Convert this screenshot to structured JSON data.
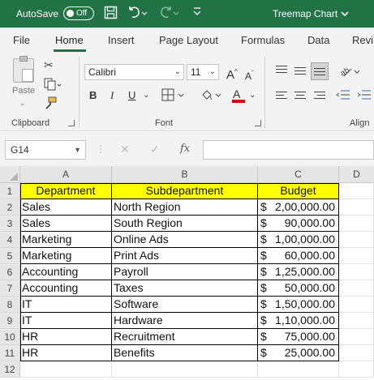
{
  "titlebar": {
    "autosave_label": "AutoSave",
    "autosave_state": "Off",
    "title": "Treemap Chart",
    "title_chevron": "⌄",
    "save_icon": "save-icon",
    "undo_icon": "undo-icon",
    "redo_icon": "redo-icon",
    "customize_icon": "customize-icon"
  },
  "menu": {
    "tabs": [
      "File",
      "Home",
      "Insert",
      "Page Layout",
      "Formulas",
      "Data",
      "Revi"
    ],
    "active": "Home"
  },
  "ribbon": {
    "clipboard": {
      "label": "Clipboard",
      "paste_label": "Paste"
    },
    "font": {
      "label": "Font",
      "font_name": "Calibri",
      "font_size": "11",
      "bold": "B",
      "italic": "I",
      "underline": "U",
      "grow": "A",
      "shrink": "A",
      "font_color": "A"
    },
    "alignment": {
      "label": "Align"
    }
  },
  "formula_bar": {
    "name_box": "G14",
    "fx_label": "fx",
    "cancel_icon": "✕",
    "enter_icon": "✓",
    "value": ""
  },
  "grid": {
    "columns": [
      "A",
      "B",
      "C",
      "D"
    ],
    "rows": [
      "1",
      "2",
      "3",
      "4",
      "5",
      "6",
      "7",
      "8",
      "9",
      "10",
      "11",
      "12"
    ],
    "header": [
      "Department",
      "Subdepartment",
      "Budget"
    ],
    "header_fill": "#ffff00",
    "data": [
      [
        "Sales",
        "North Region",
        "$",
        "2,00,000.00"
      ],
      [
        "Sales",
        "South Region",
        "$",
        "90,000.00"
      ],
      [
        "Marketing",
        "Online Ads",
        "$",
        "1,00,000.00"
      ],
      [
        "Marketing",
        "Print Ads",
        "$",
        "60,000.00"
      ],
      [
        "Accounting",
        "Payroll",
        "$",
        "1,25,000.00"
      ],
      [
        "Accounting",
        "Taxes",
        "$",
        "50,000.00"
      ],
      [
        "IT",
        "Software",
        "$",
        "1,50,000.00"
      ],
      [
        "IT",
        "Hardware",
        "$",
        "1,10,000.00"
      ],
      [
        "HR",
        "Recruitment",
        "$",
        "75,000.00"
      ],
      [
        "HR",
        "Benefits",
        "$",
        "25,000.00"
      ]
    ]
  }
}
